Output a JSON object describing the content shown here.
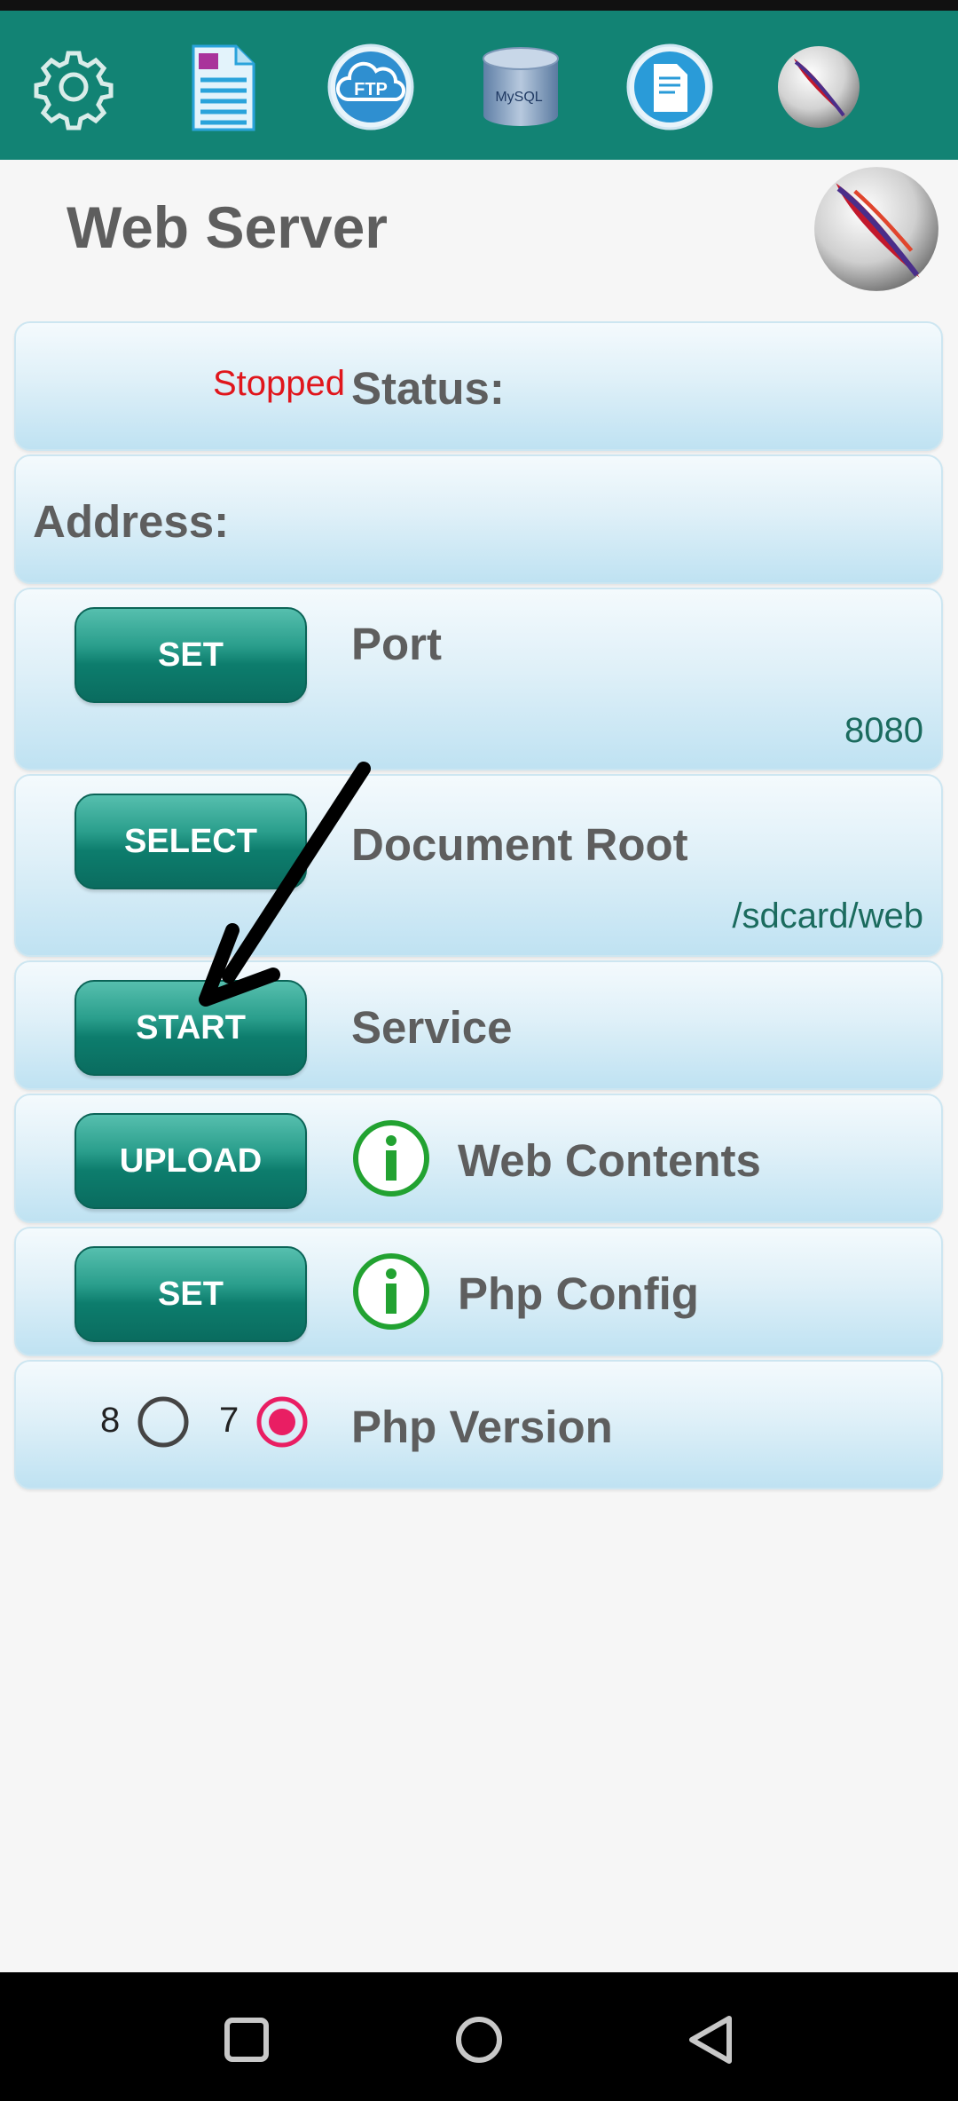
{
  "toolbar": {
    "icons": [
      "gear-icon",
      "document-icon",
      "ftp-cloud-icon",
      "mysql-database-icon",
      "log-file-icon",
      "apache-feather-icon"
    ],
    "ftp_text": "FTP",
    "mysql_text": "MySQL"
  },
  "page": {
    "title": "Web Server"
  },
  "status": {
    "value": "Stopped",
    "label": "Status:",
    "value_color": "#e0161c"
  },
  "address": {
    "label": "Address:"
  },
  "port": {
    "button": "SET",
    "label": "Port",
    "value": "8080"
  },
  "docroot": {
    "button": "SELECT",
    "label": "Document Root",
    "value": "/sdcard/web"
  },
  "service": {
    "button": "START",
    "label": "Service"
  },
  "web_contents": {
    "button": "UPLOAD",
    "label": "Web Contents"
  },
  "php_config": {
    "button": "SET",
    "label": "Php Config"
  },
  "php_version": {
    "label": "Php Version",
    "options": [
      {
        "label": "8",
        "selected": false
      },
      {
        "label": "7",
        "selected": true
      }
    ]
  },
  "colors": {
    "accent": "#128374",
    "button": "#0d7d6d",
    "radio_selected": "#e91e63"
  },
  "navbar": {
    "icons": [
      "recents-square-icon",
      "home-circle-icon",
      "back-triangle-icon"
    ]
  }
}
